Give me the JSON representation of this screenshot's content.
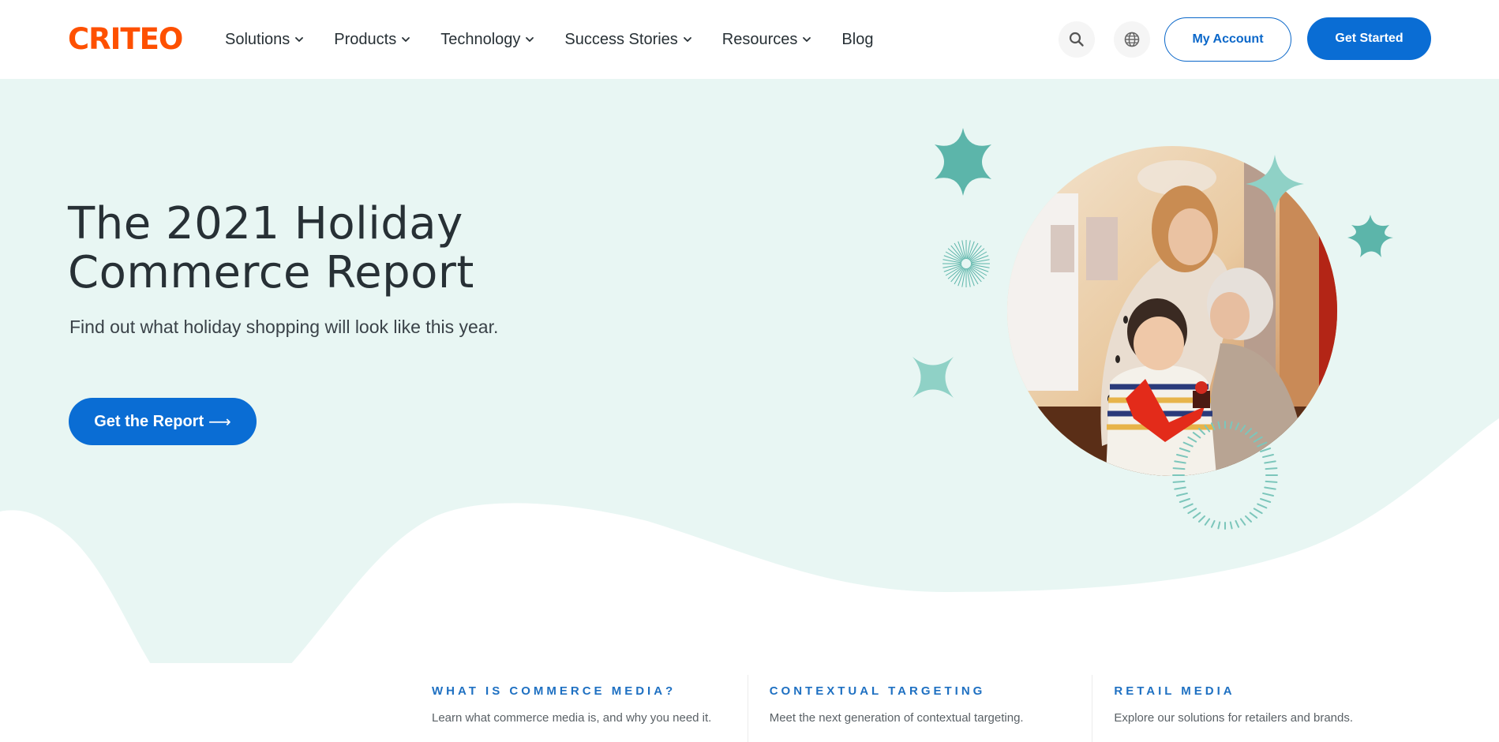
{
  "header": {
    "logo": "CRITEO",
    "nav": [
      {
        "label": "Solutions",
        "has_dropdown": true
      },
      {
        "label": "Products",
        "has_dropdown": true
      },
      {
        "label": "Technology",
        "has_dropdown": true
      },
      {
        "label": "Success Stories",
        "has_dropdown": true
      },
      {
        "label": "Resources",
        "has_dropdown": true
      },
      {
        "label": "Blog",
        "has_dropdown": false
      }
    ],
    "search_icon": "search-icon",
    "language_icon": "globe-icon",
    "my_account_label": "My Account",
    "get_started_label": "Get Started"
  },
  "hero": {
    "title": "The 2021 Holiday Commerce Report",
    "subtitle": "Find out what holiday shopping will look like this year.",
    "cta_label": "Get the Report",
    "cta_arrow": "⟶",
    "image_alt": "Family opening a holiday card together"
  },
  "features": [
    {
      "title": "WHAT IS COMMERCE MEDIA?",
      "description": "Learn what commerce media is, and why you need it."
    },
    {
      "title": "CONTEXTUAL TARGETING",
      "description": "Meet the next generation of contextual targeting."
    },
    {
      "title": "RETAIL MEDIA",
      "description": "Explore our solutions for retailers and brands."
    }
  ],
  "colors": {
    "brand_orange": "#fe5000",
    "primary_blue": "#0a6dd4",
    "hero_background": "#e8f6f3",
    "accent_teal": "#5cb8ad",
    "accent_teal_light": "#8fd1c6",
    "text_dark": "#273035",
    "feature_title_blue": "#1e70c2"
  }
}
